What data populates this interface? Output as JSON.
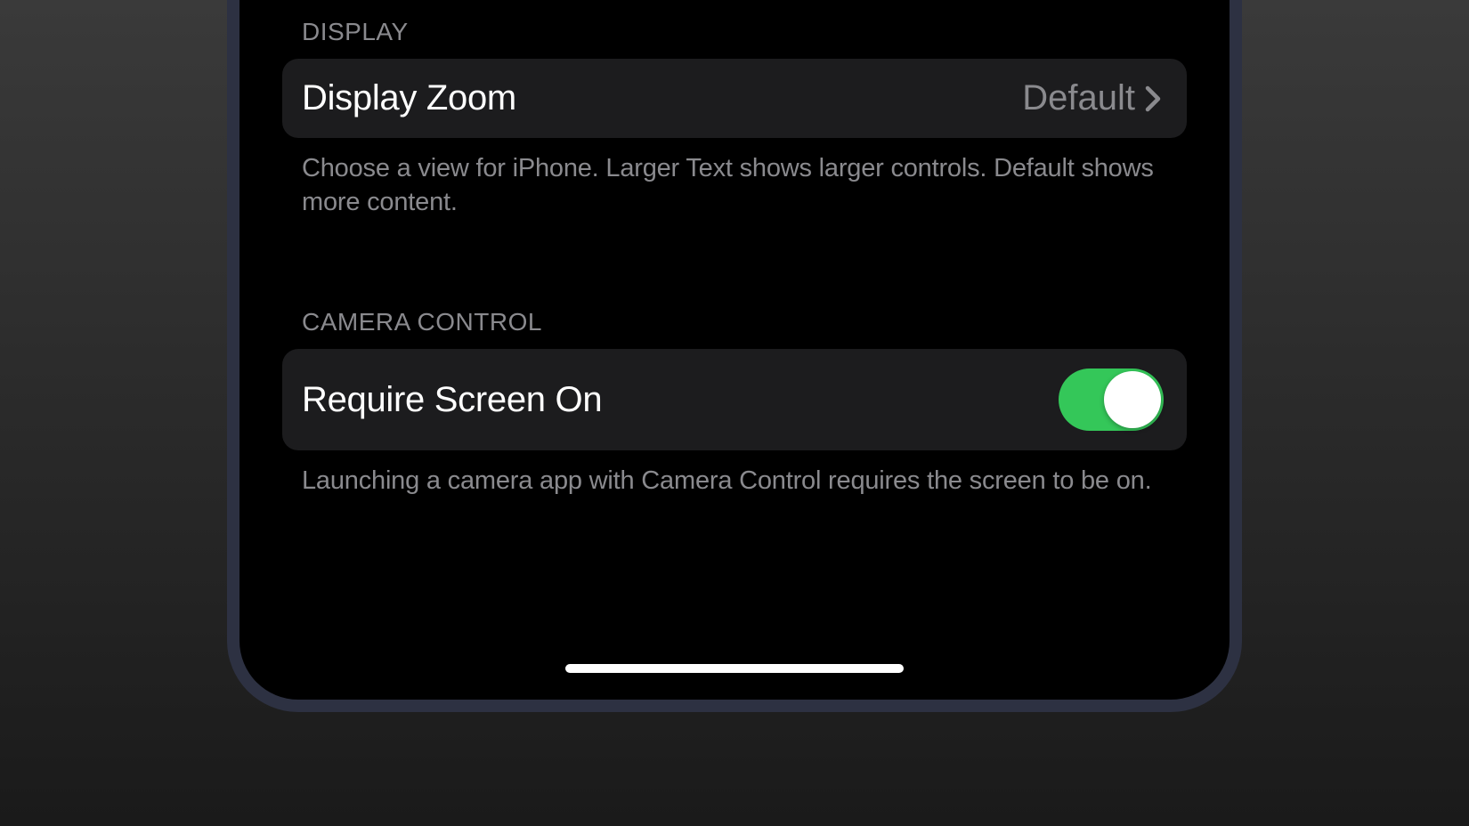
{
  "sections": {
    "display": {
      "header": "DISPLAY",
      "row": {
        "label": "Display Zoom",
        "value": "Default"
      },
      "footer": "Choose a view for iPhone. Larger Text shows larger controls. Default shows more content."
    },
    "cameraControl": {
      "header": "CAMERA CONTROL",
      "row": {
        "label": "Require Screen On",
        "toggleOn": true
      },
      "footer": "Launching a camera app with Camera Control requires the screen to be on."
    }
  }
}
